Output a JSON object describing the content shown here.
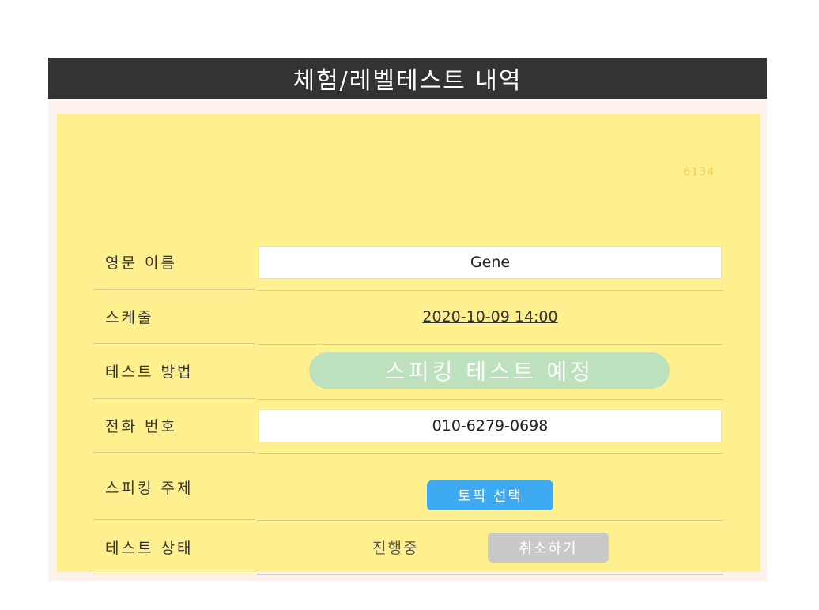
{
  "header": {
    "title": "체험/레벨테스트 내역"
  },
  "card": {
    "code": "6134",
    "rows": {
      "name": {
        "label": "영문 이름",
        "value": "Gene"
      },
      "schedule": {
        "label": "스케줄",
        "value": "2020-10-09 14:00"
      },
      "method": {
        "label": "테스트 방법",
        "value": "스피킹 테스트 예정"
      },
      "phone": {
        "label": "전화 번호",
        "value": "010-6279-0698"
      },
      "topic": {
        "label": "스피킹 주제",
        "button": "토픽 선택"
      },
      "status": {
        "label": "테스트 상태",
        "value": "진행중",
        "button": "취소하기"
      }
    }
  },
  "colors": {
    "header_bg": "#333333",
    "card_bg": "#fef08f",
    "method_pill": "#bde0bd",
    "topic_button": "#3eaaf2",
    "cancel_button": "#c9c9c9"
  }
}
